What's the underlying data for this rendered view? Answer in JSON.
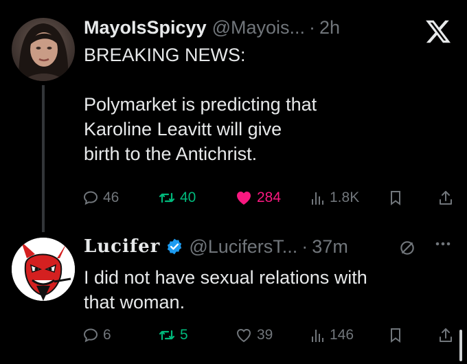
{
  "app": {
    "logo_icon": "x-logo-icon"
  },
  "tweets": [
    {
      "author": {
        "name": "MayoIsSpicyy",
        "handle": "@Mayois...",
        "time": "2h"
      },
      "lines": [
        "BREAKING NEWS:",
        "",
        "Polymarket is predicting that",
        "Karoline Leavitt will give",
        "birth to the Antichrist."
      ],
      "stats": {
        "replies": "46",
        "reposts": "40",
        "likes": "284",
        "views": "1.8K"
      },
      "liked": true
    },
    {
      "author": {
        "name": "Lucifer",
        "handle": "@LucifersT...",
        "time": "37m",
        "verified": true
      },
      "lines": [
        "I did not have sexual relations with",
        "that woman."
      ],
      "stats": {
        "replies": "6",
        "reposts": "5",
        "likes": "39",
        "views": "146"
      },
      "liked": false
    }
  ],
  "colors": {
    "background": "#000000",
    "text": "#e7e9ea",
    "muted": "#71767b",
    "repost": "#00ba7c",
    "like": "#f91880",
    "verified": "#1d9bf0"
  }
}
